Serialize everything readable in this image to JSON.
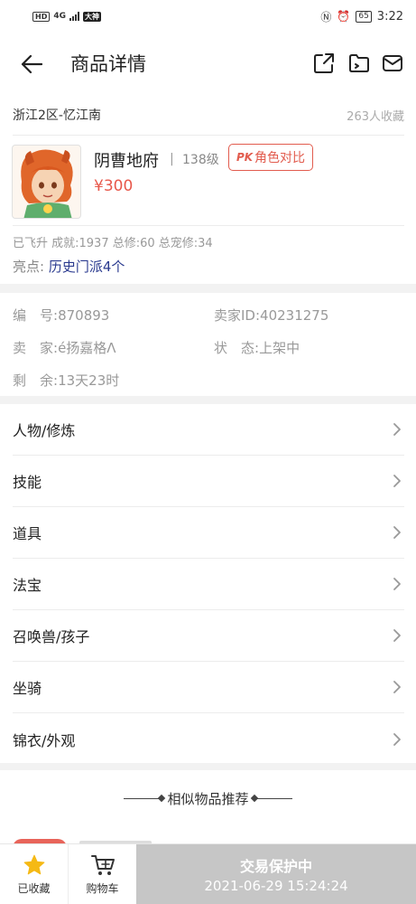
{
  "status_bar": {
    "left_labels": [
      "HD",
      "4G",
      "大神"
    ],
    "time": "3:22",
    "battery": "65"
  },
  "header": {
    "title": "商品详情",
    "icons": [
      "back-arrow-icon",
      "share-icon",
      "folder-icon",
      "mail-icon"
    ]
  },
  "item": {
    "server": "浙江2区-忆江南",
    "favorites": "263人收藏",
    "role_name": "阴曹地府",
    "separator": "|",
    "level": "138级",
    "compare_pk": "PK",
    "compare_label": "角色对比",
    "price": "¥300",
    "achievements": "已飞升 成就:1937 总修:60 总宠修:34",
    "highlight_label": "亮点:",
    "highlight_value": "历史门派4个"
  },
  "info": {
    "id_label": "编　号:",
    "id_value": "870893",
    "seller_id_label": "卖家ID:",
    "seller_id_value": "40231275",
    "seller_label": "卖　家:",
    "seller_value": "é扬嘉格Λ",
    "status_label": "状　态:",
    "status_value": "上架中",
    "remaining_label": "剩　余:",
    "remaining_value": "13天23时"
  },
  "menu": [
    {
      "label": "人物/修炼"
    },
    {
      "label": "技能"
    },
    {
      "label": "道具"
    },
    {
      "label": "法宝"
    },
    {
      "label": "召唤兽/孩子"
    },
    {
      "label": "坐骑"
    },
    {
      "label": "锦衣/外观"
    }
  ],
  "recommend": {
    "title": "相似物品推荐"
  },
  "bottom_bar": {
    "favorited_label": "已收藏",
    "cart_label": "购物车",
    "protect_title": "交易保护中",
    "protect_time": "2021-06-29 15:24:24"
  },
  "colors": {
    "price": "#e8584b",
    "highlight": "#2a3a8f",
    "star": "#f5b915",
    "protect_bg": "#c6c6c6"
  }
}
